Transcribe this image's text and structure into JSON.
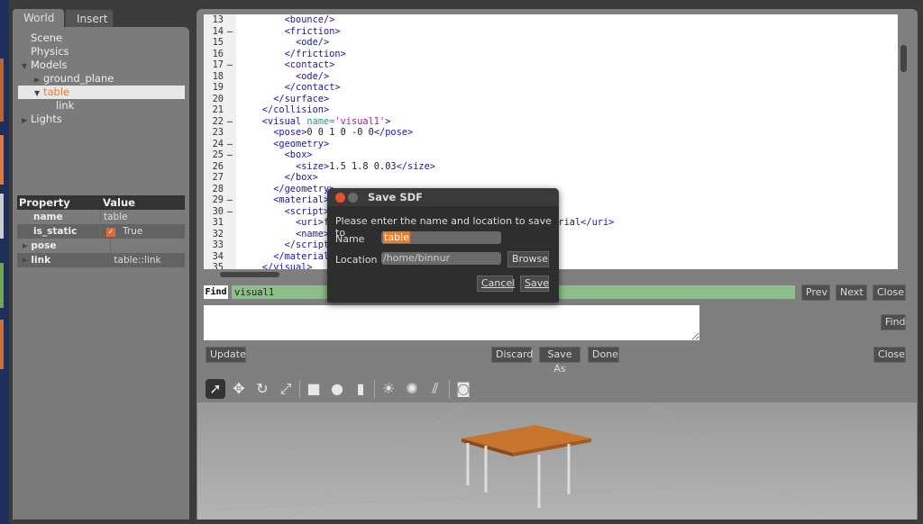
{
  "tabs": [
    {
      "label": "World"
    },
    {
      "label": "Insert"
    }
  ],
  "tree": [
    {
      "label": "Scene",
      "indent": 0,
      "arrow": ""
    },
    {
      "label": "Physics",
      "indent": 0,
      "arrow": ""
    },
    {
      "label": "Models",
      "indent": 0,
      "arrow": "▼"
    },
    {
      "label": "ground_plane",
      "indent": 1,
      "arrow": "▶"
    },
    {
      "label": "table",
      "indent": 1,
      "arrow": "▼",
      "selected": true
    },
    {
      "label": "link",
      "indent": 2,
      "arrow": ""
    },
    {
      "label": "Lights",
      "indent": 0,
      "arrow": "▶"
    }
  ],
  "properties": {
    "header": {
      "property": "Property",
      "value": "Value"
    },
    "rows": [
      {
        "key": "name",
        "value": "table"
      },
      {
        "key": "is_static",
        "value": "True",
        "checked": true
      },
      {
        "key": "pose",
        "value": ""
      },
      {
        "key": "link",
        "value": "table::link"
      }
    ]
  },
  "code_lines": [
    {
      "n": "13",
      "fold": "",
      "text": "        <bounce/>"
    },
    {
      "n": "14",
      "fold": "–",
      "text": "        <friction>"
    },
    {
      "n": "15",
      "fold": "",
      "text": "          <ode/>"
    },
    {
      "n": "16",
      "fold": "",
      "text": "        </friction>"
    },
    {
      "n": "17",
      "fold": "–",
      "text": "        <contact>"
    },
    {
      "n": "18",
      "fold": "",
      "text": "          <ode/>"
    },
    {
      "n": "19",
      "fold": "",
      "text": "        </contact>"
    },
    {
      "n": "20",
      "fold": "",
      "text": "      </surface>"
    },
    {
      "n": "21",
      "fold": "",
      "text": "    </collision>"
    },
    {
      "n": "22",
      "fold": "–",
      "text": "    <visual ",
      "attr": "name=",
      "val": "'visual1'",
      "end": ">"
    },
    {
      "n": "23",
      "fold": "",
      "text": "      <pose>",
      "plain": "0 0 1 0 -0 0",
      "end": "</pose>"
    },
    {
      "n": "24",
      "fold": "–",
      "text": "      <geometry>"
    },
    {
      "n": "25",
      "fold": "–",
      "text": "        <box>"
    },
    {
      "n": "26",
      "fold": "",
      "text": "          <size>",
      "plain": "1.5 1.8 0.03",
      "end": "</size>"
    },
    {
      "n": "27",
      "fold": "",
      "text": "        </box>"
    },
    {
      "n": "28",
      "fold": "",
      "text": "      </geometry>"
    },
    {
      "n": "29",
      "fold": "–",
      "text": "      <material>"
    },
    {
      "n": "30",
      "fold": "–",
      "text": "        <script>"
    },
    {
      "n": "31",
      "fold": "",
      "text": "          <uri>",
      "plain": "file://media/materials/scripts/gazebo.material",
      "end": "</uri>"
    },
    {
      "n": "32",
      "fold": "",
      "text": "          <name>"
    },
    {
      "n": "33",
      "fold": "",
      "text": "        </script>"
    },
    {
      "n": "34",
      "fold": "",
      "text": "      </material>"
    },
    {
      "n": "35",
      "fold": "",
      "text": "    </visual>"
    }
  ],
  "find": {
    "label": "Find",
    "value": "visual1",
    "prev": "Prev",
    "next": "Next",
    "close": "Close",
    "find_button": "Find"
  },
  "actions": {
    "update": "Update",
    "discard": "Discard",
    "save_as": "Save As",
    "done": "Done",
    "close": "Close"
  },
  "toolbar_icons": [
    "arrow-select-icon",
    "translate-icon",
    "rotate-icon",
    "scale-icon",
    "box-icon",
    "sphere-icon",
    "cylinder-icon",
    "point-light-icon",
    "spot-light-icon",
    "directional-light-icon",
    "camera-icon"
  ],
  "dialog": {
    "title": "Save SDF",
    "message": "Please enter the name and location to save to",
    "name_label": "Name",
    "name_value": "table",
    "location_label": "Location",
    "location_value": "/home/binnur",
    "browse": "Browse",
    "cancel": "Cancel",
    "save": "Save"
  },
  "colors": {
    "accent": "#f07c26",
    "find_bg": "#8dbf8a",
    "tag": "#1a1a9e",
    "attr": "#2a9a8a",
    "value": "#a01f9e"
  }
}
